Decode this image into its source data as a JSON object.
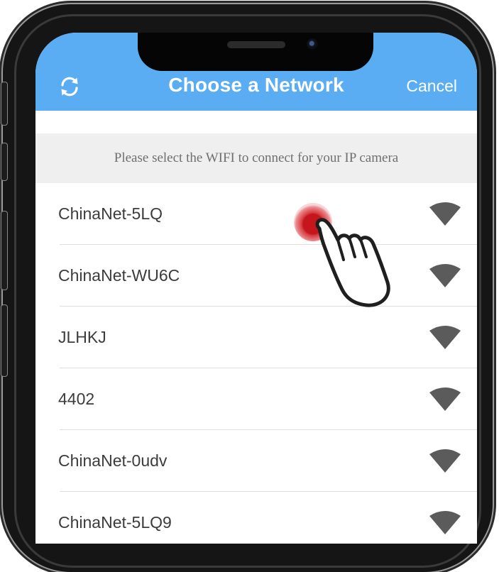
{
  "header": {
    "title": "Choose a Network",
    "cancel_label": "Cancel",
    "refresh_icon": "refresh-icon",
    "background_color": "#5aadf2"
  },
  "info_banner": {
    "text": "Please select the WIFI to connect for your IP camera"
  },
  "networks": [
    {
      "name": "ChinaNet-5LQ",
      "signal_icon": "wifi-icon"
    },
    {
      "name": "ChinaNet-WU6C",
      "signal_icon": "wifi-icon"
    },
    {
      "name": "JLHKJ",
      "signal_icon": "wifi-icon"
    },
    {
      "name": "4402",
      "signal_icon": "wifi-icon"
    },
    {
      "name": "ChinaNet-0udv",
      "signal_icon": "wifi-icon"
    },
    {
      "name": "ChinaNet-5LQ9",
      "signal_icon": "wifi-icon"
    }
  ],
  "overlay": {
    "tap_indicator_color": "#c4161c",
    "gesture_icon": "pointing-hand-icon"
  }
}
